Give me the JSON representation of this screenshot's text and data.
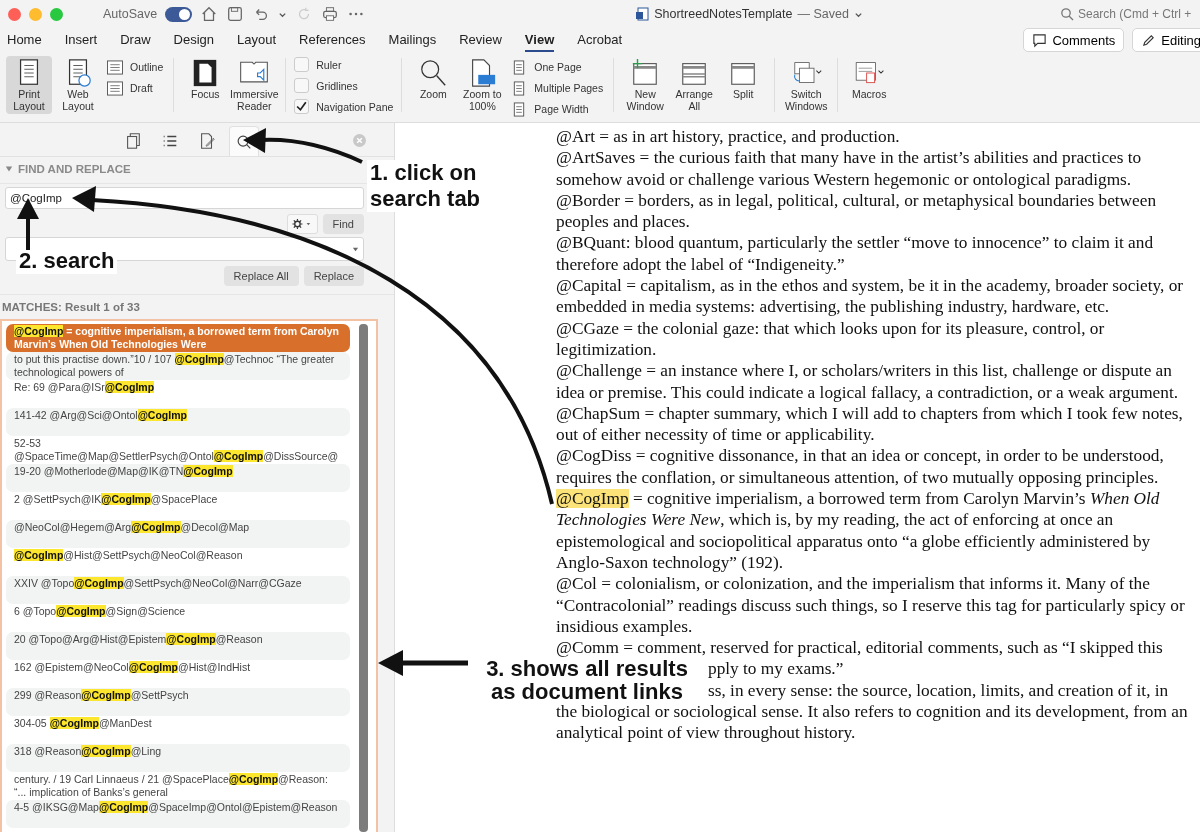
{
  "titlebar": {
    "autosave_label": "AutoSave",
    "autosave_on": true,
    "document_title": "ShortreedNotesTemplate",
    "save_status": "— Saved",
    "search_placeholder": "Search (Cmd + Ctrl +"
  },
  "ribbon_tabs": [
    {
      "label": "Home",
      "selected": false
    },
    {
      "label": "Insert",
      "selected": false
    },
    {
      "label": "Draw",
      "selected": false
    },
    {
      "label": "Design",
      "selected": false
    },
    {
      "label": "Layout",
      "selected": false
    },
    {
      "label": "References",
      "selected": false
    },
    {
      "label": "Mailings",
      "selected": false
    },
    {
      "label": "Review",
      "selected": false
    },
    {
      "label": "View",
      "selected": true
    },
    {
      "label": "Acrobat",
      "selected": false
    }
  ],
  "header_buttons": [
    {
      "kind": "comments",
      "label": "Comments"
    },
    {
      "kind": "editing",
      "label": "Editing"
    }
  ],
  "ribbon": {
    "views": [
      {
        "label": "Print Layout",
        "selected": true
      },
      {
        "label": "Web Layout",
        "selected": false
      }
    ],
    "small_views": [
      "Outline",
      "Draft"
    ],
    "immersive": [
      "Focus",
      "Immersive Reader"
    ],
    "show": [
      {
        "label": "Ruler",
        "checked": false
      },
      {
        "label": "Gridlines",
        "checked": false
      },
      {
        "label": "Navigation Pane",
        "checked": true
      }
    ],
    "zoom": [
      "Zoom",
      "Zoom to 100%"
    ],
    "page_views": [
      "One Page",
      "Multiple Pages",
      "Page Width"
    ],
    "window": [
      "New Window",
      "Arrange All",
      "Split"
    ],
    "switch_windows": "Switch Windows",
    "macros": "Macros"
  },
  "pane": {
    "tabs": [
      {
        "kind": "pages",
        "selected": false
      },
      {
        "kind": "outline",
        "selected": false
      },
      {
        "kind": "edit",
        "selected": false
      },
      {
        "kind": "search",
        "selected": true
      }
    ],
    "section_title": "FIND AND REPLACE",
    "expanded": true,
    "find_value": "@CogImp",
    "find_button": "Find",
    "replace_buttons": [
      "Replace All",
      "Replace"
    ],
    "matches_label": "MATCHES: Result 1 of 33",
    "results": [
      {
        "match": "@CogImp",
        "after": " = cognitive imperialism, a borrowed term from Carolyn Marvin’s When Old Technologies Were",
        "selected": true
      },
      {
        "before": "to put this practise down.”10 /  107 ",
        "match": "@CogImp",
        "after": "@Technoc “The greater technological powers of",
        "selected": false
      },
      {
        "before": "Re: 69 @Para@ISr",
        "match": "@CogImp",
        "selected": false
      },
      {
        "before": "141-42 @Arg@Sci@Ontol",
        "match": "@CogImp",
        "selected": false
      },
      {
        "before": "52-53 @SpaceTime@Map@SettlerPsych@Ontol",
        "match": "@CogImp",
        "after": "@DissSource@",
        "selected": false
      },
      {
        "before": "19-20 @Motherlode@Map@IK@TN",
        "match": "@CogImp",
        "selected": false
      },
      {
        "before": "2 @SettPsych@IK",
        "match": "@CogImp",
        "after": "@SpacePlace",
        "selected": false
      },
      {
        "before": "@NeoCol@Hegem@Arg",
        "match": "@CogImp",
        "after": "@Decol@Map",
        "selected": false
      },
      {
        "match": "@CogImp",
        "after": "@Hist@SettPsych@NeoCol@Reason",
        "selected": false
      },
      {
        "before": "XXIV @Topo",
        "match": "@CogImp",
        "after": "@SettPsych@NeoCol@Narr@CGaze",
        "selected": false
      },
      {
        "before": "6 @Topo",
        "match": "@CogImp",
        "after": "@Sign@Science",
        "selected": false
      },
      {
        "before": "20 @Topo@Arg@Hist@Epistem",
        "match": "@CogImp",
        "after": "@Reason",
        "selected": false
      },
      {
        "before": "162 @Epistem@NeoCol",
        "match": "@CogImp",
        "after": "@Hist@IndHist",
        "selected": false
      },
      {
        "before": "299 @Reason",
        "match": "@CogImp",
        "after": "@SettPsych",
        "selected": false
      },
      {
        "before": "304-05 ",
        "match": "@CogImp",
        "after": "@ManDest",
        "selected": false
      },
      {
        "before": "318 @Reason",
        "match": "@CogImp",
        "after": "@Ling",
        "selected": false
      },
      {
        "before": "century. / 19 Carl Linnaeus / 21 @SpacePlace",
        "match": "@CogImp",
        "after": "@Reason: “... implication of Banks’s general",
        "selected": false
      },
      {
        "before": "4-5 @IKSG@Map",
        "match": "@CogImp",
        "after": "@SpaceImp@Ontol@Epistem@Reason",
        "selected": false
      }
    ]
  },
  "document": {
    "paragraphs": [
      {
        "kind": "entry",
        "text": "@Art = as in art history, practice, and production."
      },
      {
        "kind": "entry",
        "text": "@ArtSaves = the curious faith that many have in the artist’s abilities and practices to somehow avoid or challenge various Western hegemonic or ontological paradigms."
      },
      {
        "kind": "entry",
        "text": "@Border = borders, as in legal, political, cultural, or metaphysical boundaries between peoples and places."
      },
      {
        "kind": "entry",
        "text": "@BQuant: blood quantum, particularly the settler “move to innocence” to claim it and therefore adopt the label of “Indigeneity.”"
      },
      {
        "kind": "entry",
        "text": "@Capital = capitalism, as in the ethos and system, be it in the academy, broader society, or embedded in media systems: advertising, the publishing industry, hardware, etc."
      },
      {
        "kind": "entry",
        "text": "@CGaze = the colonial gaze: that which looks upon for its pleasure, control, or legitimization."
      },
      {
        "kind": "entry",
        "text": "@Challenge = an instance where I, or scholars/writers in this list, challenge or dispute an idea or premise. This could indicate a logical fallacy, a contradiction, or a weak argument."
      },
      {
        "kind": "entry",
        "text": "@ChapSum = chapter summary, which I will add to chapters from which I took few notes, out of either necessity of time or applicability."
      },
      {
        "kind": "entry",
        "text": "@CogDiss = cognitive dissonance, in that an idea or concept, in order to be understood, requires the conflation, or simultaneous attention, of two mutually opposing principles."
      },
      {
        "kind": "match",
        "highlight": "@CogImp",
        "text": " = cognitive imperialism, a borrowed term from Carolyn Marvin’s *When Old Technologies Were New*, which is, by my reading, the act of enforcing at once an epistemological and sociopolitical apparatus onto “a globe efficiently administered by Anglo-Saxon technology” (192)."
      },
      {
        "kind": "entry",
        "text": "@Col = colonialism, or colonization, and the imperialism that informs it. Many of the “Contracolonial” readings discuss such things, so I reserve this tag for particularly spicy or insidious examples."
      },
      {
        "kind": "entry",
        "text": "@Comm = comment, reserved for practical, editorial comments, such as “I skipped this"
      },
      {
        "kind": "fragment",
        "text": "pply to my exams.”"
      },
      {
        "kind": "fragment",
        "text": "ss, in every sense: the source, location, limits, and creation of it, in"
      },
      {
        "kind": "entry",
        "text": "the biological or sociological sense. It also refers to cognition and its development, from an analytical point of view throughout history."
      }
    ]
  },
  "annotations": [
    {
      "text": "1. click on search tab"
    },
    {
      "text": "2. search"
    },
    {
      "text": "3. shows all results as document links"
    }
  ]
}
